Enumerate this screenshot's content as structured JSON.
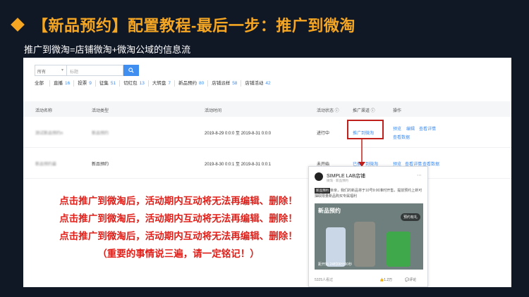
{
  "slide": {
    "title": "【新品预约】配置教程-最后一步：推广到微淘",
    "subtitle": "推广到微淘=店铺微淘+微淘公域的信息流"
  },
  "filters": {
    "select_value": "所有",
    "search_placeholder": "标题"
  },
  "tabs": [
    {
      "label": "全部",
      "count": ""
    },
    {
      "label": "直播",
      "count": "16"
    },
    {
      "label": "投票",
      "count": "9"
    },
    {
      "label": "征集",
      "count": "51"
    },
    {
      "label": "切红包",
      "count": "13"
    },
    {
      "label": "大转盘",
      "count": "7"
    },
    {
      "label": "新品预约",
      "count": "80"
    },
    {
      "label": "店铺派样",
      "count": "58"
    },
    {
      "label": "店铺活动",
      "count": "42"
    }
  ],
  "table": {
    "headers": {
      "name": "活动名称",
      "type": "活动类型",
      "time": "活动时间",
      "status": "活动状态 ⓘ",
      "channel": "推广渠道 ⓘ",
      "ops": "操作"
    },
    "rows": [
      {
        "name": "测试新品预约n",
        "type": "新品预约",
        "time": "2019-8-29 0:0:0 至 2019-8-31 0:0:0",
        "status": "进行中",
        "channel": "推广到微淘",
        "ops": [
          "预览",
          "编辑",
          "查看详情",
          "查看数据"
        ]
      },
      {
        "name": "新品预约最",
        "type": "新品预约",
        "time": "2019-8-30 0:0:1 至 2019-8-31 0:0:1",
        "status": "未开始",
        "channel": "已推广到微淘",
        "ops": [
          "预览",
          "查看详情",
          "查看数据"
        ]
      }
    ]
  },
  "notes": [
    "点击推广到微淘后，活动期内互动将无法再编辑、删除！",
    "点击推广到微淘后，活动期内互动将无法再编辑、删除！",
    "点击推广到微淘后，活动期内互动将无法再编辑、删除！",
    "（重要的事情说三遍，请一定铭记！）"
  ],
  "phone_preview": {
    "shop_name": "SIMPLE LAB店铺",
    "meta": "微淘 · 新品预约",
    "tag": "新品预约",
    "text": "亲亲，我们的新品将于10号9:00准时开售，提前预约上新可抽取限量新品购买专属福利",
    "image_badge": "新品预约",
    "preorder_btn": "预约有礼",
    "countdown": "距开始 24时00分00秒",
    "footer_views": "5325人看过",
    "likes": "1.2万",
    "comment": "评论"
  },
  "colors": {
    "title_orange": "#f5a623",
    "link_blue": "#3f8ef0",
    "note_red": "#e0201a",
    "highlight_red": "#c0201c"
  }
}
